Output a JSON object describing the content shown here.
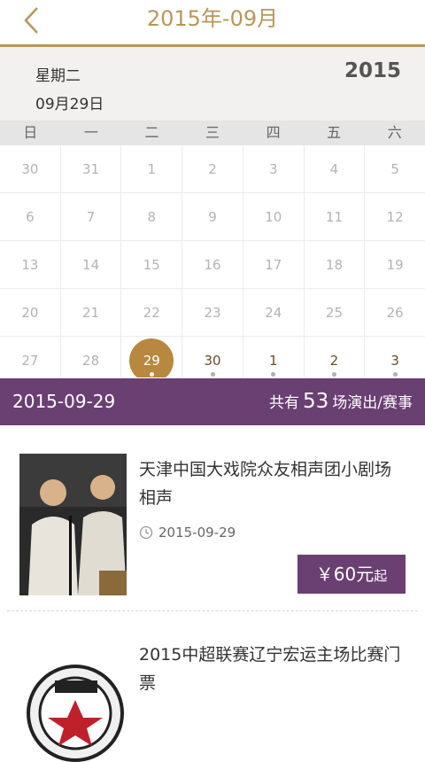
{
  "header": {
    "title": "2015年-09月"
  },
  "date_info": {
    "weekday": "星期二",
    "date": "09月29日",
    "year": "2015"
  },
  "weekdays": [
    "日",
    "一",
    "二",
    "三",
    "四",
    "五",
    "六"
  ],
  "calendar": {
    "rows": [
      [
        "30",
        "31",
        "1",
        "2",
        "3",
        "4",
        "5"
      ],
      [
        "6",
        "7",
        "8",
        "9",
        "10",
        "11",
        "12"
      ],
      [
        "13",
        "14",
        "15",
        "16",
        "17",
        "18",
        "19"
      ],
      [
        "20",
        "21",
        "22",
        "23",
        "24",
        "25",
        "26"
      ],
      [
        "27",
        "28",
        "29",
        "30",
        "1",
        "2",
        "3"
      ]
    ]
  },
  "summary": {
    "date": "2015-09-29",
    "prefix": "共有",
    "count": "53",
    "suffix": "场演出/赛事"
  },
  "events": [
    {
      "title": "天津中国大戏院众友相声团小剧场相声",
      "date": "2015-09-29",
      "price": "￥60元",
      "price_suffix": "起"
    },
    {
      "title": "2015中超联赛辽宁宏运主场比赛门票"
    }
  ],
  "colors": {
    "accent": "#b8965a",
    "purple": "#6a3f72",
    "selected": "#b8883e"
  }
}
